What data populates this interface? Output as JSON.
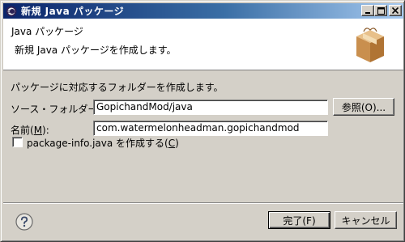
{
  "window": {
    "title": "新規 Java パッケージ"
  },
  "banner": {
    "title": "Java パッケージ",
    "message": "新規 Java パッケージを作成します。",
    "icon": "package-icon"
  },
  "form": {
    "description": "パッケージに対応するフォルダーを作成します。",
    "source_folder_label_pre": "ソース・フォルダー(",
    "source_folder_mnemonic": "D",
    "source_folder_label_post": "):",
    "source_folder_value": "GopichandMod/java",
    "browse_label": "参照(O)...",
    "name_label_pre": "名前(",
    "name_mnemonic": "M",
    "name_label_post": "):",
    "name_value": "com.watermelonheadman.gopichandmod",
    "checkbox_label_pre": "package-info.java を作成する(",
    "checkbox_mnemonic": "C",
    "checkbox_label_post": ")",
    "checkbox_checked": false
  },
  "footer": {
    "help_icon": "help-icon",
    "finish_label": "完了(F)",
    "cancel_label": "キャンセル"
  },
  "colors": {
    "titlebar_start": "#0a246a",
    "titlebar_end": "#a6caf0",
    "face": "#d4d0c8"
  }
}
